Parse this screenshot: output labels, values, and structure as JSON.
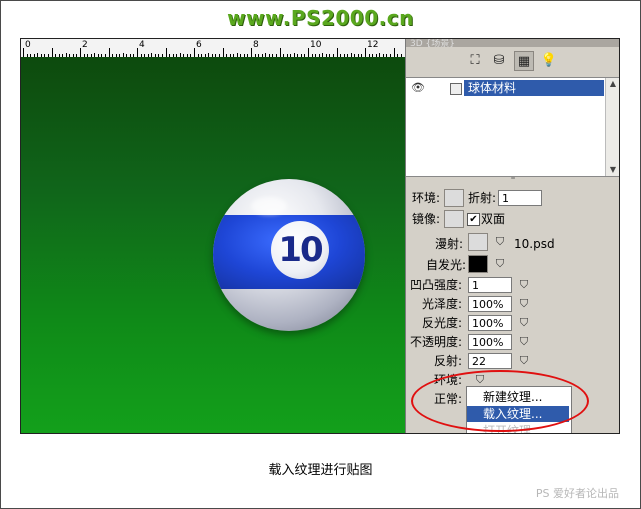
{
  "banner": "www.PS2000.cn",
  "ruler": {
    "labels": [
      "0",
      "2",
      "4",
      "6",
      "8",
      "10",
      "12"
    ]
  },
  "ball": {
    "number": "10"
  },
  "panel": {
    "title": "3D {场景}",
    "layer_name": "球体材料",
    "props": {
      "env_label": "环境:",
      "refract_label": "折射:",
      "refract_value": "1",
      "mirror_label": "镜像:",
      "double_label": "双面",
      "diffuse_label": "漫射:",
      "diffuse_texture": "10.psd",
      "emissive_label": "自发光:",
      "bump_label": "凹凸强度:",
      "bump_value": "1",
      "gloss_label": "光泽度:",
      "gloss_value": "100%",
      "shine_label": "反光度:",
      "shine_value": "100%",
      "opacity_label": "不透明度:",
      "opacity_value": "100%",
      "reflect_label": "反射:",
      "reflect_value": "22",
      "env2_label": "环境:",
      "normal_label": "正常:"
    },
    "menu": {
      "items": [
        "新建纹理...",
        "载入纹理...",
        "打开纹理"
      ]
    }
  },
  "caption": "载入纹理进行贴图",
  "credit": "PS 爱好者论出品",
  "colors": {
    "highlight": "#2f5bab",
    "annotation": "#e01010",
    "banner": "#5aa81e"
  }
}
